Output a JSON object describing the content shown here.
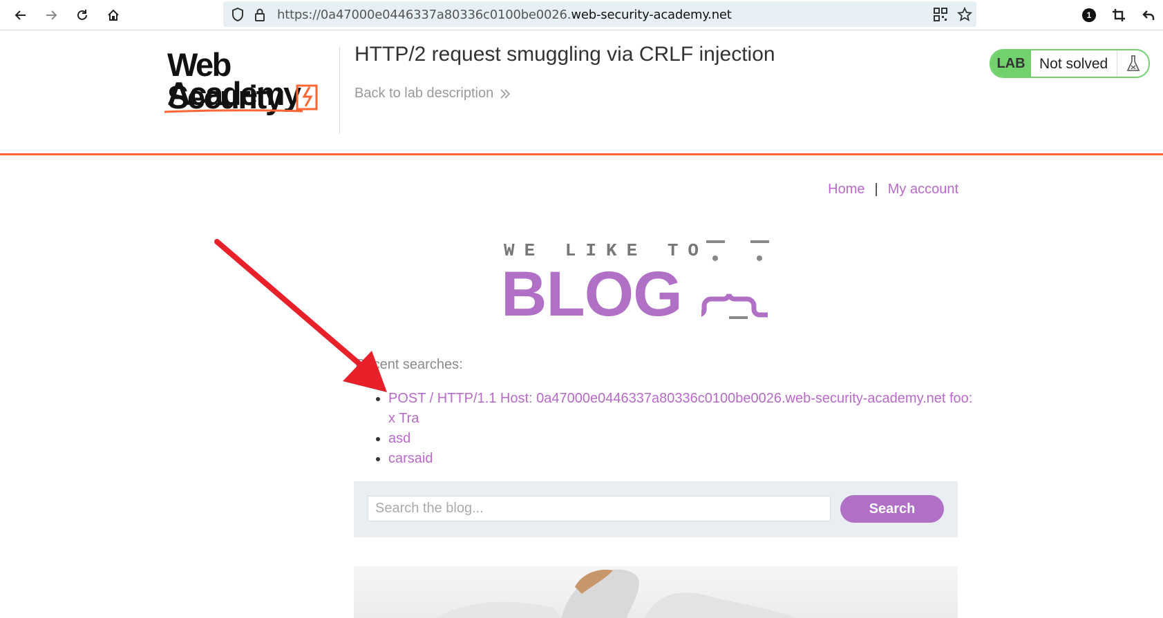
{
  "browser": {
    "url_prefix": "https://0a47000e0446337a80336c0100be0026.",
    "url_host": "web-security-academy.net",
    "extension_badge": "1",
    "icons": [
      "back-icon",
      "forward-icon",
      "reload-icon",
      "home-icon",
      "shield-icon",
      "lock-icon",
      "qr-code-icon",
      "star-icon",
      "extension-icon",
      "crop-icon",
      "undo-icon"
    ]
  },
  "lab": {
    "logo_line1": "Web Security",
    "logo_line2": "Academy",
    "title": "HTTP/2 request smuggling via CRLF injection",
    "back_link": "Back to lab description",
    "status_lab": "LAB",
    "status_text": "Not solved",
    "accent_color": "#ff6633",
    "status_color": "#70d16d"
  },
  "nav": {
    "home": "Home",
    "separator": "|",
    "my_account": "My account",
    "link_color": "#b86ac9"
  },
  "blog_header": {
    "tagline": "WE LIKE TO",
    "title": "BLOG",
    "brand_color": "#b070c6"
  },
  "recent": {
    "label": "Recent searches:",
    "items": [
      "POST / HTTP/1.1 Host: 0a47000e0446337a80336c0100be0026.web-security-academy.net foo: x Tra",
      "asd",
      "carsaid"
    ]
  },
  "search": {
    "placeholder": "Search the blog...",
    "button": "Search"
  }
}
